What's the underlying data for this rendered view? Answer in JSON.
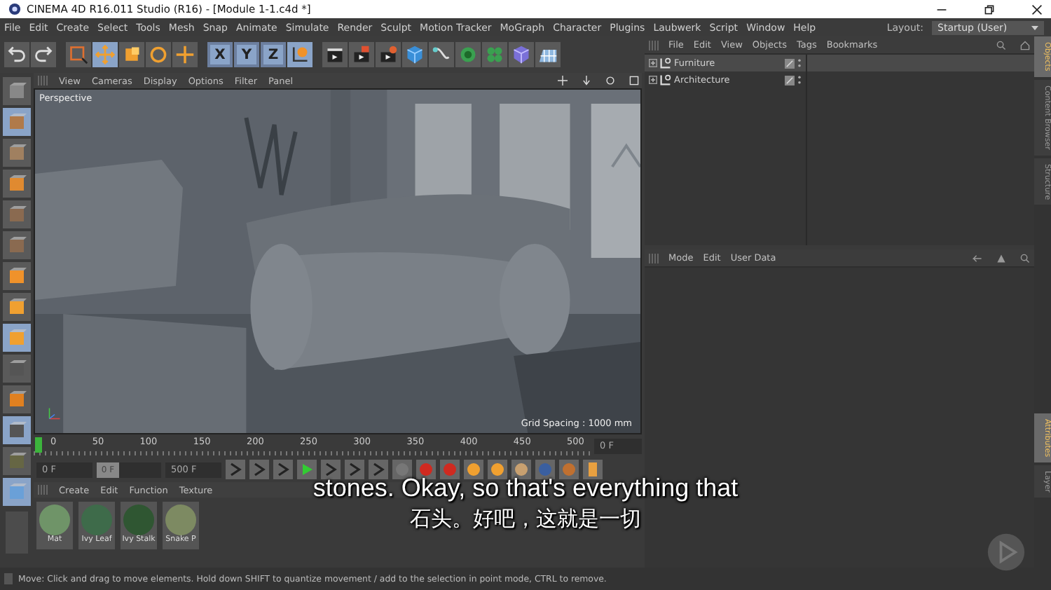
{
  "window": {
    "title": "CINEMA 4D R16.011 Studio (R16) - [Module 1-1.c4d *]"
  },
  "menu_bar": [
    "File",
    "Edit",
    "Create",
    "Select",
    "Tools",
    "Mesh",
    "Snap",
    "Animate",
    "Simulate",
    "Render",
    "Sculpt",
    "Motion Tracker",
    "MoGraph",
    "Character",
    "Plugins",
    "Laubwerk",
    "Script",
    "Window",
    "Help"
  ],
  "layout": {
    "label": "Layout:",
    "value": "Startup (User)"
  },
  "toolbar": {
    "axes": [
      {
        "label": "X",
        "on": true
      },
      {
        "label": "Y",
        "on": true
      },
      {
        "label": "Z",
        "on": true
      }
    ]
  },
  "viewport": {
    "menu": [
      "View",
      "Cameras",
      "Display",
      "Options",
      "Filter",
      "Panel"
    ],
    "camera": "Perspective",
    "grid_spacing": "Grid Spacing : 1000 mm"
  },
  "timeline": {
    "ticks": [
      "0",
      "50",
      "100",
      "150",
      "200",
      "250",
      "300",
      "350",
      "400",
      "450",
      "500"
    ],
    "end_field": "0 F"
  },
  "transport": {
    "start": "0 F",
    "slider": {
      "value": "0 F",
      "level": 0
    },
    "end": "500 F"
  },
  "material_manager": {
    "menu": [
      "Create",
      "Edit",
      "Function",
      "Texture"
    ],
    "materials": [
      {
        "name": "Mat",
        "color": "#6f9468"
      },
      {
        "name": "Ivy Leaf",
        "color": "#3e6b4a"
      },
      {
        "name": "Ivy Stalk",
        "color": "#2f5632"
      },
      {
        "name": "Snake P",
        "color": "#7d8a62"
      }
    ]
  },
  "object_manager": {
    "menu": [
      "File",
      "Edit",
      "View",
      "Objects",
      "Tags",
      "Bookmarks"
    ],
    "objects": [
      {
        "name": "Furniture",
        "selected": true
      },
      {
        "name": "Architecture",
        "selected": false
      }
    ]
  },
  "attribute_manager": {
    "menu": [
      "Mode",
      "Edit",
      "User Data"
    ]
  },
  "side_tabs_top": [
    {
      "label": "Objects",
      "selected": true
    },
    {
      "label": "Content Browser",
      "selected": false
    },
    {
      "label": "Structure",
      "selected": false
    }
  ],
  "side_tabs_bottom": [
    {
      "label": "Attributes",
      "selected": true
    },
    {
      "label": "Layer",
      "selected": false
    }
  ],
  "status_bar": "Move: Click and drag to move elements. Hold down SHIFT to quantize movement / add to the selection in point mode, CTRL to remove.",
  "subtitles": [
    "stones. Okay, so that's everything that",
    "石头。好吧，这就是一切"
  ]
}
